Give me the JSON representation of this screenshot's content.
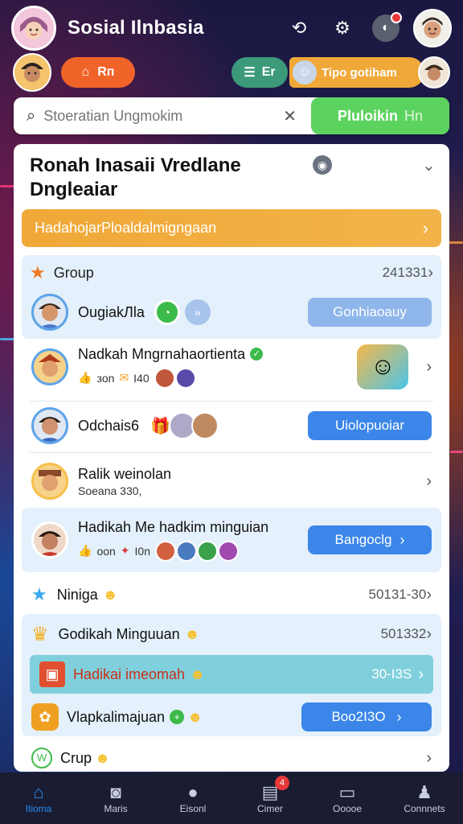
{
  "colors": {
    "accent": "#3b86e8",
    "green": "#5dd35f",
    "orange": "#f0a838",
    "teal": "#7fd0dc",
    "nav_active": "#2a8cf0",
    "badge": "#e8383a"
  },
  "header": {
    "title": "Sosial Ilnbasia",
    "icons": [
      "refresh-icon",
      "gear-icon",
      "notification-icon"
    ]
  },
  "row2": {
    "home_pill": "Rп",
    "chat_pill": "Er",
    "promo_pill": "Tipo gotiham"
  },
  "search": {
    "placeholder": "Stoeratian Ungmokim",
    "button": "Pluloikin",
    "button_suffix": "Hn"
  },
  "card": {
    "title_line1": "Ronah Inasaii Vredlane",
    "title_line2": "Dngleaiar",
    "banner": "HadahojarРloaldalmigngaan",
    "group": {
      "label": "Group",
      "count": "241331"
    },
    "rows": [
      {
        "name": "OugiakЛla",
        "action": "Gonhiaoauy"
      },
      {
        "name": "Nadkah Mngrnahaortienta",
        "meta1": "зon",
        "meta2": "I40"
      },
      {
        "name": "Odchais6",
        "action": "Uiolopuoiar"
      },
      {
        "name": "Ralik weinolan",
        "sub": "Soeana 330,"
      },
      {
        "name": "Hadikah Me hadkim minguian",
        "meta1": "oon",
        "meta2": "I0n",
        "action": "Bangoclg"
      }
    ],
    "ninga": {
      "label": "Niniga",
      "count": "50131-30"
    },
    "group2": {
      "item1": {
        "label": "Godikah Minguuan",
        "count": "501332"
      },
      "item2": {
        "label": "Hadikai imeomah",
        "count": "30-I3S"
      },
      "item3": {
        "label": "Vlapkalimajuan",
        "action": "Boo2I3O"
      }
    },
    "crup": {
      "label": "Crup"
    }
  },
  "nav": [
    {
      "label": "Itioma",
      "icon": "home-icon",
      "active": true
    },
    {
      "label": "Maris",
      "icon": "camera-icon"
    },
    {
      "label": "Eisonl",
      "icon": "chat-bubble-icon"
    },
    {
      "label": "Cimer",
      "icon": "inbox-icon",
      "badge": "4"
    },
    {
      "label": "Ooooe",
      "icon": "card-icon"
    },
    {
      "label": "Connnets",
      "icon": "person-icon"
    }
  ]
}
